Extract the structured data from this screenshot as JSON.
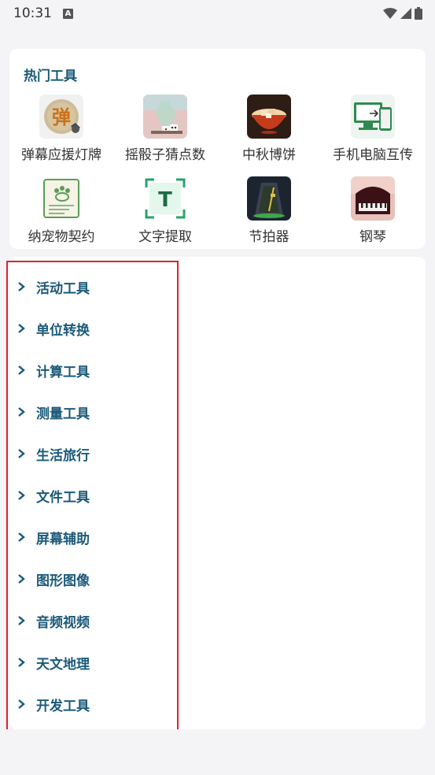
{
  "status_bar": {
    "time": "10:31",
    "notification_letter": "A"
  },
  "hot_tools": {
    "title": "热门工具",
    "items": [
      {
        "label": "弹幕应援灯牌",
        "icon": "danmu-lightboard-icon",
        "glyph": "弹"
      },
      {
        "label": "摇骰子猜点数",
        "icon": "dice-icon"
      },
      {
        "label": "中秋博饼",
        "icon": "mooncake-bowl-icon"
      },
      {
        "label": "手机电脑互传",
        "icon": "phone-pc-transfer-icon"
      },
      {
        "label": "纳宠物契约",
        "icon": "pet-contract-icon"
      },
      {
        "label": "文字提取",
        "icon": "text-extract-icon",
        "glyph": "T"
      },
      {
        "label": "节拍器",
        "icon": "metronome-icon"
      },
      {
        "label": "钢琴",
        "icon": "piano-icon"
      }
    ]
  },
  "categories": [
    "活动工具",
    "单位转换",
    "计算工具",
    "测量工具",
    "生活旅行",
    "文件工具",
    "屏幕辅助",
    "图形图像",
    "音频视频",
    "天文地理",
    "开发工具"
  ],
  "colors": {
    "accent": "#1b5a7a",
    "highlight_border": "#d9262b",
    "background": "#f4f4f6"
  }
}
